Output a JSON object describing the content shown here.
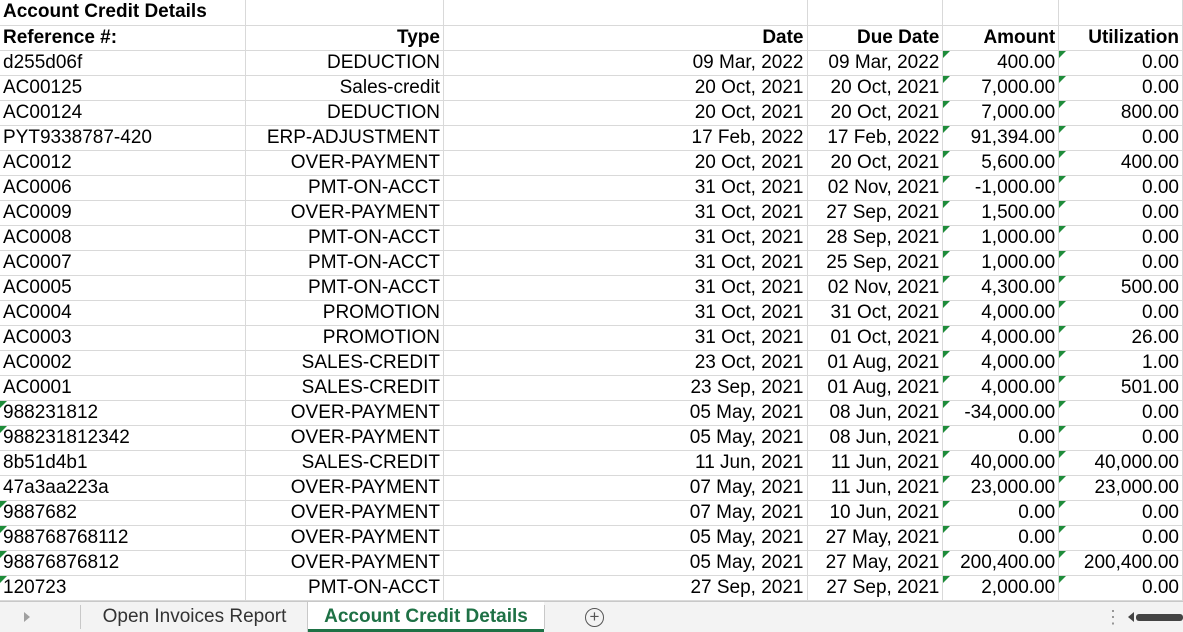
{
  "sheet": {
    "title": "Account Credit Details",
    "headers": {
      "reference": "Reference #:",
      "type": "Type",
      "date": "Date",
      "due_date": "Due Date",
      "amount": "Amount",
      "utilization": "Utilization"
    },
    "rows": [
      {
        "ref": "d255d06f",
        "type": "DEDUCTION",
        "date": "09 Mar, 2022",
        "due": "09 Mar, 2022",
        "amount": "400.00",
        "util": "0.00",
        "refFlag": false
      },
      {
        "ref": "AC00125",
        "type": "Sales-credit",
        "date": "20 Oct, 2021",
        "due": "20 Oct, 2021",
        "amount": "7,000.00",
        "util": "0.00",
        "refFlag": false
      },
      {
        "ref": "AC00124",
        "type": "DEDUCTION",
        "date": "20 Oct, 2021",
        "due": "20 Oct, 2021",
        "amount": "7,000.00",
        "util": "800.00",
        "refFlag": false
      },
      {
        "ref": "PYT9338787-420",
        "type": "ERP-ADJUSTMENT",
        "date": "17 Feb, 2022",
        "due": "17 Feb, 2022",
        "amount": "91,394.00",
        "util": "0.00",
        "refFlag": false
      },
      {
        "ref": "AC0012",
        "type": "OVER-PAYMENT",
        "date": "20 Oct, 2021",
        "due": "20 Oct, 2021",
        "amount": "5,600.00",
        "util": "400.00",
        "refFlag": false
      },
      {
        "ref": "AC0006",
        "type": "PMT-ON-ACCT",
        "date": "31 Oct, 2021",
        "due": "02 Nov, 2021",
        "amount": "-1,000.00",
        "util": "0.00",
        "refFlag": false
      },
      {
        "ref": "AC0009",
        "type": "OVER-PAYMENT",
        "date": "31 Oct, 2021",
        "due": "27 Sep, 2021",
        "amount": "1,500.00",
        "util": "0.00",
        "refFlag": false
      },
      {
        "ref": "AC0008",
        "type": "PMT-ON-ACCT",
        "date": "31 Oct, 2021",
        "due": "28 Sep, 2021",
        "amount": "1,000.00",
        "util": "0.00",
        "refFlag": false
      },
      {
        "ref": "AC0007",
        "type": "PMT-ON-ACCT",
        "date": "31 Oct, 2021",
        "due": "25 Sep, 2021",
        "amount": "1,000.00",
        "util": "0.00",
        "refFlag": false
      },
      {
        "ref": "AC0005",
        "type": "PMT-ON-ACCT",
        "date": "31 Oct, 2021",
        "due": "02 Nov, 2021",
        "amount": "4,300.00",
        "util": "500.00",
        "refFlag": false
      },
      {
        "ref": "AC0004",
        "type": "PROMOTION",
        "date": "31 Oct, 2021",
        "due": "31 Oct, 2021",
        "amount": "4,000.00",
        "util": "0.00",
        "refFlag": false
      },
      {
        "ref": "AC0003",
        "type": "PROMOTION",
        "date": "31 Oct, 2021",
        "due": "01 Oct, 2021",
        "amount": "4,000.00",
        "util": "26.00",
        "refFlag": false
      },
      {
        "ref": "AC0002",
        "type": "SALES-CREDIT",
        "date": "23 Oct, 2021",
        "due": "01 Aug, 2021",
        "amount": "4,000.00",
        "util": "1.00",
        "refFlag": false
      },
      {
        "ref": "AC0001",
        "type": "SALES-CREDIT",
        "date": "23 Sep, 2021",
        "due": "01 Aug, 2021",
        "amount": "4,000.00",
        "util": "501.00",
        "refFlag": false
      },
      {
        "ref": "988231812",
        "type": "OVER-PAYMENT",
        "date": "05 May, 2021",
        "due": "08 Jun, 2021",
        "amount": "-34,000.00",
        "util": "0.00",
        "refFlag": true
      },
      {
        "ref": "988231812342",
        "type": "OVER-PAYMENT",
        "date": "05 May, 2021",
        "due": "08 Jun, 2021",
        "amount": "0.00",
        "util": "0.00",
        "refFlag": true
      },
      {
        "ref": "8b51d4b1",
        "type": "SALES-CREDIT",
        "date": "11 Jun, 2021",
        "due": "11 Jun, 2021",
        "amount": "40,000.00",
        "util": "40,000.00",
        "refFlag": false
      },
      {
        "ref": "47a3aa223a",
        "type": "OVER-PAYMENT",
        "date": "07 May, 2021",
        "due": "11 Jun, 2021",
        "amount": "23,000.00",
        "util": "23,000.00",
        "refFlag": false
      },
      {
        "ref": "9887682",
        "type": "OVER-PAYMENT",
        "date": "07 May, 2021",
        "due": "10 Jun, 2021",
        "amount": "0.00",
        "util": "0.00",
        "refFlag": true
      },
      {
        "ref": "988768768112",
        "type": "OVER-PAYMENT",
        "date": "05 May, 2021",
        "due": "27 May, 2021",
        "amount": "0.00",
        "util": "0.00",
        "refFlag": true
      },
      {
        "ref": "98876876812",
        "type": "OVER-PAYMENT",
        "date": "05 May, 2021",
        "due": "27 May, 2021",
        "amount": "200,400.00",
        "util": "200,400.00",
        "refFlag": true
      },
      {
        "ref": "120723",
        "type": "PMT-ON-ACCT",
        "date": "27 Sep, 2021",
        "due": "27 Sep, 2021",
        "amount": "2,000.00",
        "util": "0.00",
        "refFlag": true
      }
    ]
  },
  "tabs": {
    "items": [
      {
        "label": "Open Invoices Report",
        "active": false
      },
      {
        "label": "Account Credit Details",
        "active": true
      }
    ],
    "add_label": "+",
    "more_label": "⋮"
  },
  "colors": {
    "active_tab": "#1e7145",
    "error_flag": "#1e8c3a",
    "gridline": "#d9d9d9"
  }
}
